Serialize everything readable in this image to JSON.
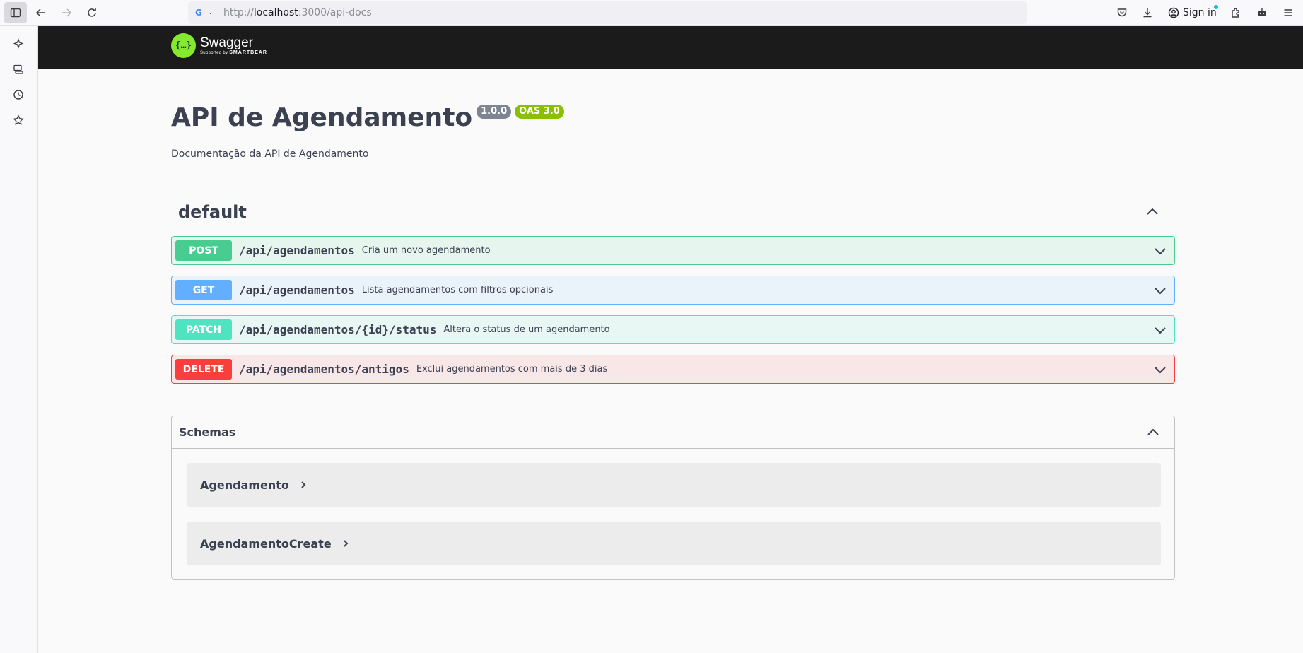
{
  "browser": {
    "url_scheme": "http://",
    "url_host": "localhost",
    "url_rest": ":3000/api-docs",
    "sign_in_label": "Sign in"
  },
  "swagger": {
    "logo_name": "Swagger",
    "logo_supported": "Supported by",
    "logo_brand": "SMARTBEAR"
  },
  "api": {
    "title": "API de Agendamento",
    "version": "1.0.0",
    "oas": "OAS 3.0",
    "description": "Documentação da API de Agendamento"
  },
  "tag": {
    "name": "default"
  },
  "operations": [
    {
      "method": "POST",
      "path": "/api/agendamentos",
      "summary": "Cria um novo agendamento",
      "color": "#49cc90"
    },
    {
      "method": "GET",
      "path": "/api/agendamentos",
      "summary": "Lista agendamentos com filtros opcionais",
      "color": "#61affe"
    },
    {
      "method": "PATCH",
      "path": "/api/agendamentos/{id}/status",
      "summary": "Altera o status de um agendamento",
      "color": "#50e3c2"
    },
    {
      "method": "DELETE",
      "path": "/api/agendamentos/antigos",
      "summary": "Exclui agendamentos com mais de 3 dias",
      "color": "#f93e3e"
    }
  ],
  "schemas": {
    "title": "Schemas",
    "models": [
      "Agendamento",
      "AgendamentoCreate"
    ]
  },
  "icons": {
    "sidebar": [
      "sidebar-toggle-icon",
      "ai-chat-icon",
      "synced-tabs-icon",
      "history-icon",
      "bookmarks-icon"
    ],
    "toolbar": [
      "back-icon",
      "forward-icon",
      "reload-icon",
      "pocket-icon",
      "downloads-icon",
      "account-icon",
      "extensions-icon",
      "robot-icon",
      "menu-icon"
    ]
  }
}
